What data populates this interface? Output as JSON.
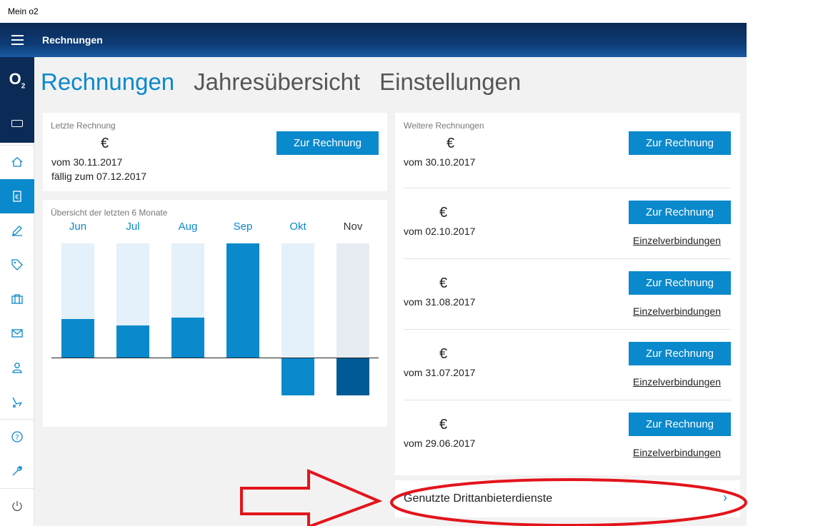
{
  "window": {
    "title": "Mein o2"
  },
  "header": {
    "title": "Rechnungen"
  },
  "brand": {
    "logo": "O",
    "logo_sub": "2"
  },
  "rail": {
    "items": [
      {
        "name": "home-icon"
      },
      {
        "name": "euro-bill-icon",
        "active": true
      },
      {
        "name": "pen-icon"
      },
      {
        "name": "tag-icon"
      },
      {
        "name": "briefcase-icon"
      },
      {
        "name": "mail-icon"
      },
      {
        "name": "person-icon"
      },
      {
        "name": "roaming-icon"
      },
      {
        "name": "help-icon"
      },
      {
        "name": "wrench-icon"
      },
      {
        "name": "power-icon"
      }
    ]
  },
  "tabs": [
    {
      "label": "Rechnungen",
      "active": true
    },
    {
      "label": "Jahresübersicht"
    },
    {
      "label": "Einstellungen"
    }
  ],
  "last_invoice": {
    "label": "Letzte Rechnung",
    "currency": "€",
    "date": "vom 30.11.2017",
    "due": "fällig zum 07.12.2017",
    "button": "Zur Rechnung"
  },
  "overview": {
    "label": "Übersicht der letzten 6 Monate"
  },
  "chart_data": {
    "type": "bar",
    "categories": [
      "Jun",
      "Jul",
      "Aug",
      "Sep",
      "Okt",
      "Nov"
    ],
    "values": [
      0.34,
      0.28,
      0.35,
      1.0,
      -0.33,
      -0.33
    ],
    "current": "Nov",
    "colors": {
      "fill": "#0a89cc",
      "background": "#e4f1fa",
      "current_fill": "#005a96",
      "current_background": "#e6ecf2"
    }
  },
  "more_invoices": {
    "label": "Weitere Rechnungen",
    "items": [
      {
        "currency": "€",
        "date": "vom 30.10.2017",
        "button": "Zur Rechnung"
      },
      {
        "currency": "€",
        "date": "vom 02.10.2017",
        "button": "Zur Rechnung",
        "link": "Einzelverbindungen"
      },
      {
        "currency": "€",
        "date": "vom 31.08.2017",
        "button": "Zur Rechnung",
        "link": "Einzelverbindungen"
      },
      {
        "currency": "€",
        "date": "vom 31.07.2017",
        "button": "Zur Rechnung",
        "link": "Einzelverbindungen"
      },
      {
        "currency": "€",
        "date": "vom 29.06.2017",
        "button": "Zur Rechnung",
        "link": "Einzelverbindungen"
      }
    ]
  },
  "third_party": {
    "label": "Genutzte Drittanbieterdienste",
    "chevron": "›"
  },
  "colors": {
    "accent": "#0a89cc",
    "header": "#0b2a55",
    "annotation": "#e3141b"
  }
}
